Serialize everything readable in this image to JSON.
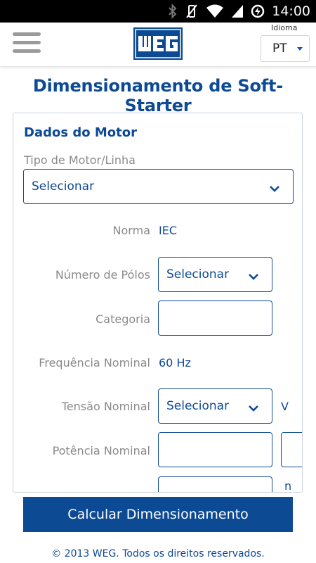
{
  "status_bar": {
    "time": "14:00",
    "icons": [
      "bluetooth-icon",
      "vibrate-off-icon",
      "wifi-icon",
      "signal-icon",
      "battery-charging-icon"
    ]
  },
  "header": {
    "menu_icon": "hamburger-menu-icon",
    "logo_text": "WEG",
    "language_label": "Idioma",
    "language_value": "PT"
  },
  "page": {
    "title": "Dimensionamento de Soft-Starter"
  },
  "motor_section": {
    "title": "Dados do Motor",
    "tipo_label": "Tipo de Motor/Linha",
    "tipo_value": "Selecionar",
    "norma_label": "Norma",
    "norma_value": "IEC",
    "polos_label": "Número de Pólos",
    "polos_value": "Selecionar",
    "categoria_label": "Categoria",
    "categoria_value": "",
    "frequencia_label": "Frequência Nominal",
    "frequencia_value": "60 Hz",
    "tensao_label": "Tensão Nominal",
    "tensao_value": "Selecionar",
    "tensao_unit": "V",
    "potencia_label": "Potência Nominal",
    "potencia_value": "",
    "next_unit_partial": "n"
  },
  "actions": {
    "calculate_label": "Calcular Dimensionamento"
  },
  "footer": {
    "text": "© 2013 WEG. Todos os direitos reservados."
  }
}
